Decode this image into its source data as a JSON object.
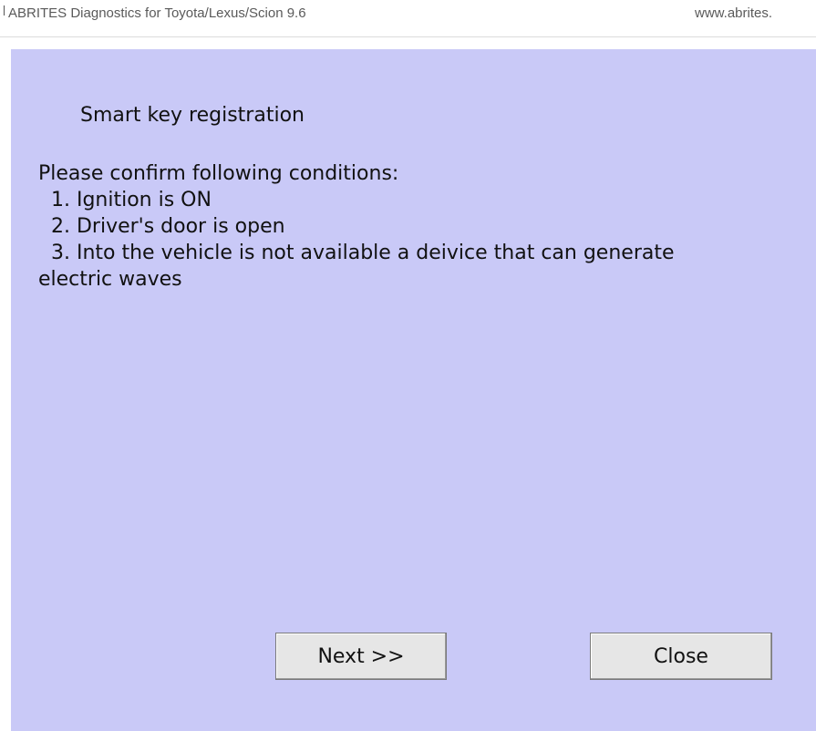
{
  "window": {
    "title": "ABRITES Diagnostics for Toyota/Lexus/Scion 9.6",
    "url": "www.abrites."
  },
  "dialog": {
    "title": "Smart key registration",
    "lines": [
      "Please confirm following conditions:",
      "  1. Ignition is ON",
      "  2. Driver's door is open",
      "  3. Into the vehicle is not available a deivice that can generate",
      "electric waves"
    ],
    "buttons": {
      "next": "Next >>",
      "close": "Close"
    }
  },
  "colors": {
    "dialog_background": "#c9c9f7",
    "button_background": "#e6e6e6"
  }
}
